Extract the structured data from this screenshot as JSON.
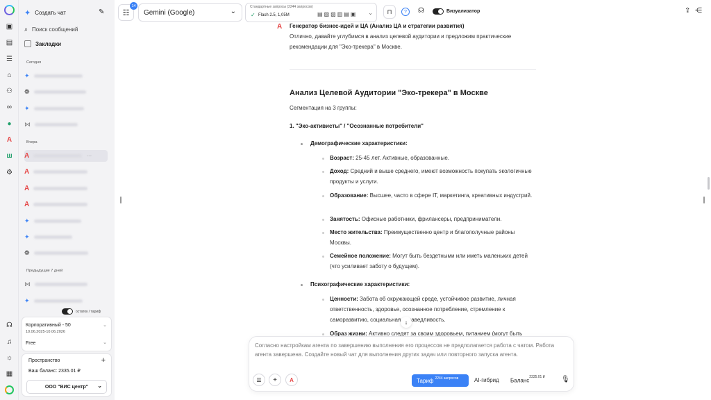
{
  "rail": {
    "badge_letter": "A"
  },
  "sidebar": {
    "new_chat": "Создать чат",
    "search": "Поиск сообщений",
    "bookmarks": "Закладки",
    "sections": {
      "today": "Сегодня",
      "yesterday": "Вчера",
      "prev7": "Предыдущие 7 дней"
    },
    "remaining_label": "остаток / тариф",
    "plan": {
      "name": "Корпоративный - 50",
      "dates": "10.06.2025-10.06.2026",
      "tier": "Free"
    },
    "space": {
      "title": "Пространство",
      "add": "+",
      "balance": "Ваш баланс: 2335.01 ₽",
      "org": "ООО \"ВИС центр\""
    }
  },
  "topbar": {
    "notif_count": "14",
    "model": "Gemini (Google)",
    "std_requests": "Стандартные запросы (2244 запросов)",
    "model_variant": "Flash 2.5, 1,05M",
    "visualizer": "Визуализатор"
  },
  "message": {
    "agent_icon": "A",
    "agent_name": "Генератор бизнес-идей и ЦА (Анализ ЦА и стратегии развития)",
    "intro": "Отлично, давайте углубимся в анализ целевой аудитории и предложим практические рекомендации для \"Эко-трекера\" в Москве.",
    "heading": "Анализ Целевой Аудитории \"Эко-трекера\" в Москве",
    "segmentation": "Сегментация на 3 группы:",
    "group1": "1. \"Эко-активисты\" / \"Осознанные потребители\"",
    "demographics": "Демографические характеристики:",
    "demo_items": [
      {
        "k": "Возраст:",
        "v": " 25-45 лет. Активные, образованные."
      },
      {
        "k": "Доход:",
        "v": " Средний и выше среднего, имеют возможность покупать экологичные продукты и услуги."
      },
      {
        "k": "Образование:",
        "v": " Высшее, часто в сфере IT, маркетинга, креативных индустрий."
      },
      {
        "k": "Занятость:",
        "v": " Офисные работники, фрилансеры, предприниматели."
      },
      {
        "k": "Место жительства:",
        "v": " Преимущественно центр и благополучные районы Москвы."
      },
      {
        "k": "Семейное положение:",
        "v": " Могут быть бездетными или иметь маленьких детей (что усиливает заботу о будущем)."
      }
    ],
    "psycho": "Психографические характеристики:",
    "psycho_items": [
      {
        "k": "Ценности:",
        "v": " Забота об окружающей среде, устойчивое развитие, личная ответственность, здоровье, осознанное потребление, стремление к саморазвитию, социальная справедливость."
      },
      {
        "k": "Образ жизни:",
        "v": " Активно следят за своим здоровьем, питанием (могут быть"
      }
    ]
  },
  "composer": {
    "notice": "Согласно настройкам агента по завершению выполнения его процессов не предполагается работа с чатом. Работа агента завершена. Создайте новый чат для выполнения других задач или повторного запуска агента.",
    "tariff": "Тариф",
    "tariff_sup": "2244 запросов",
    "hybrid": "AI-гибрид",
    "balance": "Баланс",
    "balance_sup": "2335.01 ₽"
  }
}
